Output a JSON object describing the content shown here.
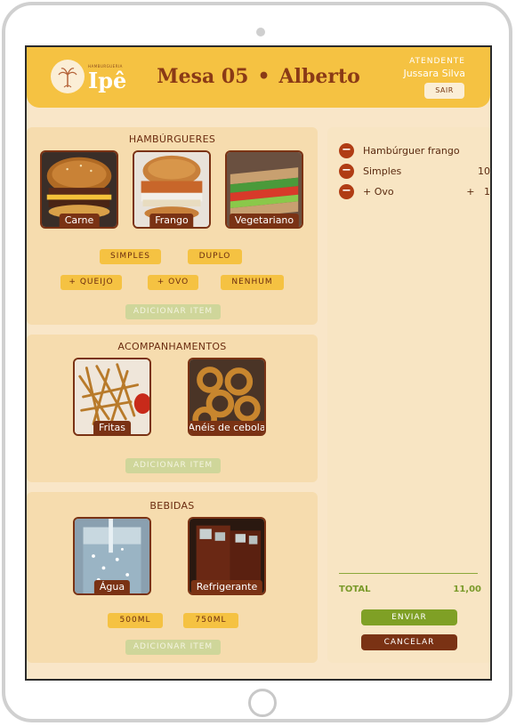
{
  "header": {
    "logo_small": "HAMBURGUERIA",
    "logo_big": "Ipê",
    "table": "Mesa 05",
    "customer": "Alberto",
    "separator": "•",
    "attendant_label": "ATENDENTE",
    "attendant_name": "Jussara Silva",
    "logout_label": "SAIR"
  },
  "burgers": {
    "title": "HAMBÚRGUERES",
    "items": [
      {
        "label": "Carne",
        "icon": "beef-burger-photo"
      },
      {
        "label": "Frango",
        "icon": "chicken-burger-photo"
      },
      {
        "label": "Vegetariano",
        "icon": "veggie-sandwich-photo"
      }
    ],
    "sizes": [
      "SIMPLES",
      "DUPLO"
    ],
    "extras": [
      "+ QUEIJO",
      "+ OVO",
      "NENHUM"
    ],
    "add_label": "ADICIONAR ITEM"
  },
  "sides": {
    "title": "ACOMPANHAMENTOS",
    "items": [
      {
        "label": "Fritas",
        "icon": "fries-photo"
      },
      {
        "label": "Anéis de cebola",
        "icon": "onion-rings-photo"
      }
    ],
    "add_label": "ADICIONAR ITEM"
  },
  "drinks": {
    "title": "BEBIDAS",
    "items": [
      {
        "label": "Água",
        "icon": "water-photo"
      },
      {
        "label": "Refrigerante",
        "icon": "soda-photo"
      }
    ],
    "sizes": [
      "500ML",
      "750ML"
    ],
    "add_label": "ADICIONAR ITEM"
  },
  "order": {
    "lines": [
      {
        "name": "Hambúrguer frango",
        "value": ""
      },
      {
        "name": "Simples",
        "value": "10"
      },
      {
        "name": "+ Ovo",
        "value": "+   1"
      }
    ],
    "total_label": "TOTAL",
    "total_value": "11,00",
    "send_label": "ENVIAR",
    "cancel_label": "CANCELAR"
  },
  "colors": {
    "header": "#f5c242",
    "background": "#f9e6c8",
    "accent_brown": "#7a3214",
    "accent_green": "#7fa025"
  }
}
